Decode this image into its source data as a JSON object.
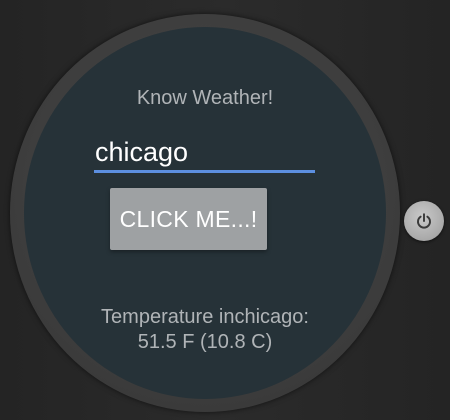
{
  "app": {
    "title": "Know Weather!"
  },
  "city_input": {
    "value": "chicago"
  },
  "action_button": {
    "label": "CLICK ME...!"
  },
  "result": {
    "line1": "Temperature inchicago:",
    "line2": "51.5 F (10.8 C)"
  },
  "hardware": {
    "power_icon": "power-icon"
  },
  "colors": {
    "face": "#263238",
    "input_underline": "#5c8fe0",
    "button": "#9ea1a3"
  }
}
